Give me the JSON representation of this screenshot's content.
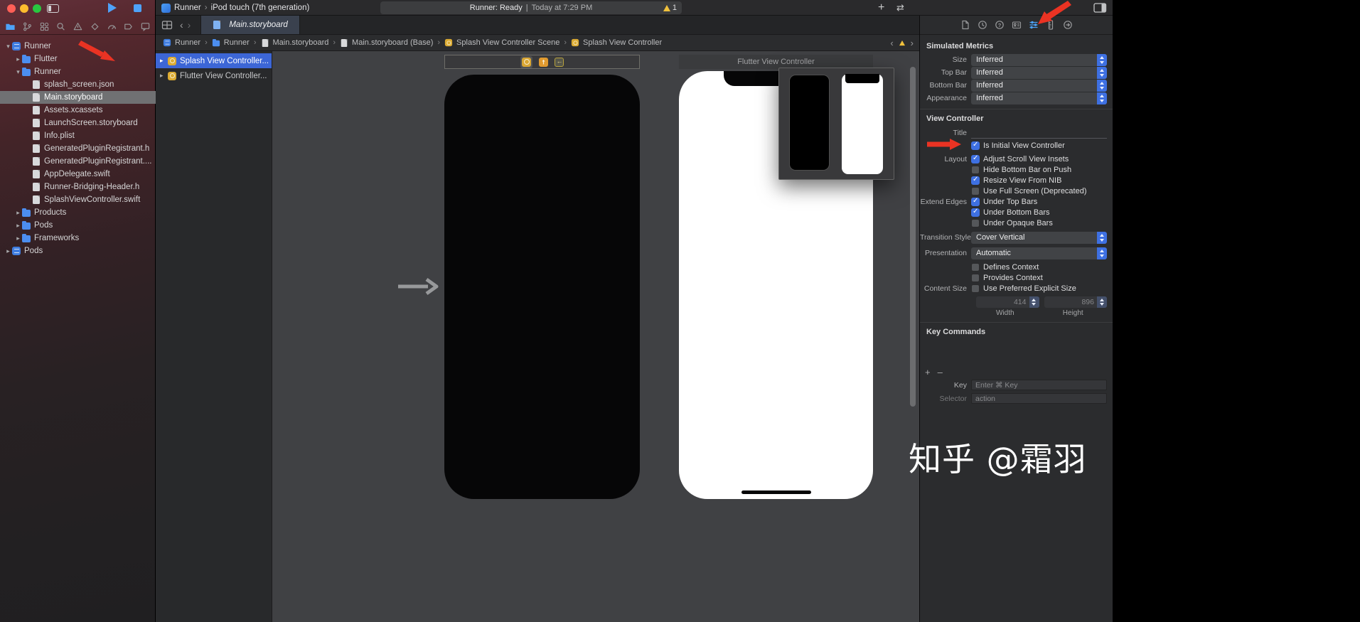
{
  "watermark": "知乎 @霜羽",
  "colors": {
    "accent_blue": "#3e70e2",
    "selection_blue": "#3c66d6",
    "warning_yellow": "#f0c13c",
    "annotation_red": "#ea3323",
    "sidebar_tint_red": "#56282e"
  },
  "toolbar": {
    "scheme_name": "Runner",
    "destination": "iPod touch (7th generation)",
    "status_left": "Runner: Ready",
    "status_sep": "|",
    "status_right": "Today at 7:29 PM",
    "warning_count": "1",
    "library_button": "+"
  },
  "navigator": {
    "items": [
      {
        "label": "Runner",
        "icon": "proj",
        "indent": 0,
        "chevron": "down",
        "selected": false
      },
      {
        "label": "Flutter",
        "icon": "folder",
        "indent": 1,
        "chevron": "right",
        "selected": false
      },
      {
        "label": "Runner",
        "icon": "folder",
        "indent": 1,
        "chevron": "down",
        "selected": false
      },
      {
        "label": "splash_screen.json",
        "icon": "doc",
        "indent": 2,
        "chevron": "",
        "selected": false
      },
      {
        "label": "Main.storyboard",
        "icon": "doc",
        "indent": 2,
        "chevron": "",
        "selected": true
      },
      {
        "label": "Assets.xcassets",
        "icon": "doc",
        "indent": 2,
        "chevron": "",
        "selected": false
      },
      {
        "label": "LaunchScreen.storyboard",
        "icon": "doc",
        "indent": 2,
        "chevron": "",
        "selected": false
      },
      {
        "label": "Info.plist",
        "icon": "doc",
        "indent": 2,
        "chevron": "",
        "selected": false
      },
      {
        "label": "GeneratedPluginRegistrant.h",
        "icon": "doc",
        "indent": 2,
        "chevron": "",
        "selected": false
      },
      {
        "label": "GeneratedPluginRegistrant....",
        "icon": "doc",
        "indent": 2,
        "chevron": "",
        "selected": false
      },
      {
        "label": "AppDelegate.swift",
        "icon": "doc",
        "indent": 2,
        "chevron": "",
        "selected": false
      },
      {
        "label": "Runner-Bridging-Header.h",
        "icon": "doc",
        "indent": 2,
        "chevron": "",
        "selected": false
      },
      {
        "label": "SplashViewController.swift",
        "icon": "doc",
        "indent": 2,
        "chevron": "",
        "selected": false
      },
      {
        "label": "Products",
        "icon": "folder",
        "indent": 1,
        "chevron": "right",
        "selected": false
      },
      {
        "label": "Pods",
        "icon": "folder",
        "indent": 1,
        "chevron": "right",
        "selected": false
      },
      {
        "label": "Frameworks",
        "icon": "folder",
        "indent": 1,
        "chevron": "right",
        "selected": false
      },
      {
        "label": "Pods",
        "icon": "proj",
        "indent": 0,
        "chevron": "right",
        "selected": false
      }
    ]
  },
  "editor": {
    "tab_label": "Main.storyboard",
    "breadcrumb": [
      {
        "label": "Runner",
        "icon": "proj"
      },
      {
        "label": "Runner",
        "icon": "folder"
      },
      {
        "label": "Main.storyboard",
        "icon": "doc"
      },
      {
        "label": "Main.storyboard (Base)",
        "icon": "doc"
      },
      {
        "label": "Splash View Controller Scene",
        "icon": "vc"
      },
      {
        "label": "Splash View Controller",
        "icon": "vc"
      }
    ],
    "outline": [
      {
        "label": "Splash View Controller...",
        "selected": true
      },
      {
        "label": "Flutter View Controller...",
        "selected": false
      }
    ],
    "canvas": {
      "flutter_scene_label": "Flutter View Controller"
    }
  },
  "inspector": {
    "simulated_metrics": {
      "title": "Simulated Metrics",
      "rows": [
        {
          "label": "Size",
          "value": "Inferred"
        },
        {
          "label": "Top Bar",
          "value": "Inferred"
        },
        {
          "label": "Bottom Bar",
          "value": "Inferred"
        },
        {
          "label": "Appearance",
          "value": "Inferred"
        }
      ]
    },
    "view_controller": {
      "title": "View Controller",
      "title_field_label": "Title",
      "checks_a": [
        {
          "lead": "",
          "label": "Is Initial View Controller",
          "checked": true
        },
        {
          "lead": "Layout",
          "label": "Adjust Scroll View Insets",
          "checked": true
        },
        {
          "lead": "",
          "label": "Hide Bottom Bar on Push",
          "checked": false
        },
        {
          "lead": "",
          "label": "Resize View From NIB",
          "checked": true
        },
        {
          "lead": "",
          "label": "Use Full Screen (Deprecated)",
          "checked": false
        },
        {
          "lead": "Extend Edges",
          "label": "Under Top Bars",
          "checked": true
        },
        {
          "lead": "",
          "label": "Under Bottom Bars",
          "checked": true
        },
        {
          "lead": "",
          "label": "Under Opaque Bars",
          "checked": false
        }
      ],
      "dropdowns": [
        {
          "label": "Transition Style",
          "value": "Cover Vertical"
        },
        {
          "label": "Presentation",
          "value": "Automatic"
        }
      ],
      "checks_b": [
        {
          "lead": "",
          "label": "Defines Context",
          "checked": false
        },
        {
          "lead": "",
          "label": "Provides Context",
          "checked": false
        },
        {
          "lead": "Content Size",
          "label": "Use Preferred Explicit Size",
          "checked": false
        }
      ],
      "content_size": {
        "width_value": "414",
        "height_value": "896",
        "width_label": "Width",
        "height_label": "Height"
      }
    },
    "key_commands": {
      "title": "Key Commands",
      "key_label": "Key",
      "key_placeholder": "Enter ⌘ Key",
      "selector_label": "Selector",
      "selector_value": "action"
    }
  }
}
